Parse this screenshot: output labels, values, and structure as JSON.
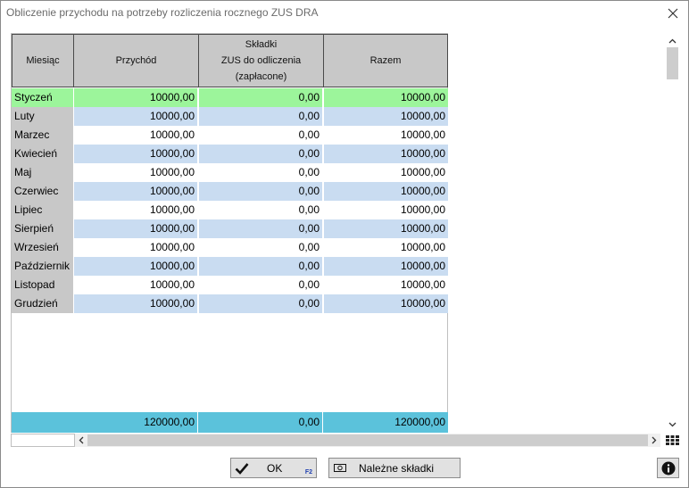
{
  "window": {
    "title": "Obliczenie przychodu na potrzeby rozliczenia rocznego ZUS DRA"
  },
  "table": {
    "headers": {
      "month": "Miesiąc",
      "income": "Przychód",
      "zus_line1": "Składki",
      "zus_line2": "ZUS do odliczenia",
      "zus_line3": "(zapłacone)",
      "total": "Razem"
    },
    "selected_row": 0,
    "rows": [
      {
        "month": "Styczeń",
        "income": "10000,00",
        "zus": "0,00",
        "total": "10000,00"
      },
      {
        "month": "Luty",
        "income": "10000,00",
        "zus": "0,00",
        "total": "10000,00"
      },
      {
        "month": "Marzec",
        "income": "10000,00",
        "zus": "0,00",
        "total": "10000,00"
      },
      {
        "month": "Kwiecień",
        "income": "10000,00",
        "zus": "0,00",
        "total": "10000,00"
      },
      {
        "month": "Maj",
        "income": "10000,00",
        "zus": "0,00",
        "total": "10000,00"
      },
      {
        "month": "Czerwiec",
        "income": "10000,00",
        "zus": "0,00",
        "total": "10000,00"
      },
      {
        "month": "Lipiec",
        "income": "10000,00",
        "zus": "0,00",
        "total": "10000,00"
      },
      {
        "month": "Sierpień",
        "income": "10000,00",
        "zus": "0,00",
        "total": "10000,00"
      },
      {
        "month": "Wrzesień",
        "income": "10000,00",
        "zus": "0,00",
        "total": "10000,00"
      },
      {
        "month": "Październik",
        "income": "10000,00",
        "zus": "0,00",
        "total": "10000,00"
      },
      {
        "month": "Listopad",
        "income": "10000,00",
        "zus": "0,00",
        "total": "10000,00"
      },
      {
        "month": "Grudzień",
        "income": "10000,00",
        "zus": "0,00",
        "total": "10000,00"
      }
    ],
    "totals": {
      "income": "120000,00",
      "zus": "0,00",
      "total": "120000,00"
    }
  },
  "buttons": {
    "ok_label": "OK",
    "ok_shortcut": "F2",
    "contributions_label": "Należne składki"
  },
  "icons": {
    "close": "close-icon",
    "ok": "checkmark-icon",
    "contributions": "banknote-icon",
    "info": "info-icon",
    "grid": "grid-icon"
  },
  "colors": {
    "selected_row": "#9cf59b",
    "alt_row": "#c9dcf1",
    "totals_row": "#5bc2db",
    "header_bg": "#c8c8c8"
  }
}
